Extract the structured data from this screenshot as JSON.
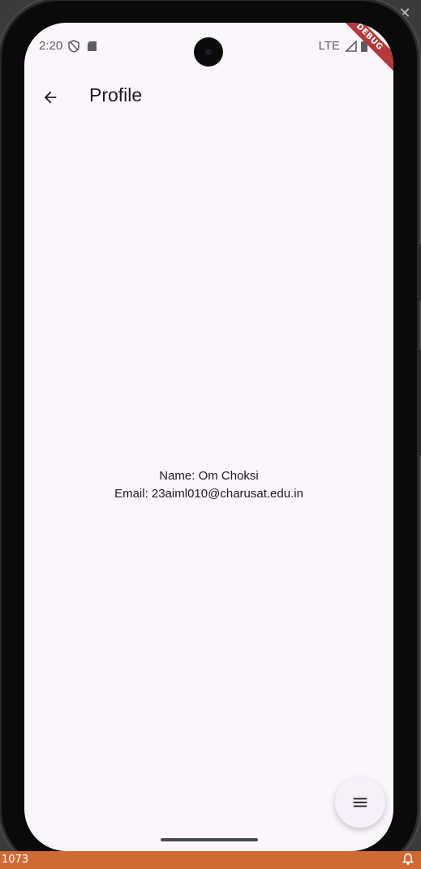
{
  "status_bar": {
    "time": "2:20",
    "network": "LTE",
    "icons_left": [
      "shield-icon",
      "sd-card-icon"
    ],
    "icons_right": [
      "signal-icon",
      "battery-icon"
    ]
  },
  "debug_banner": "DEBUG",
  "appbar": {
    "title": "Profile",
    "back_icon": "arrow-back-icon"
  },
  "profile": {
    "name_line": "Name: Om Choksi",
    "email_line": "Email: 23aiml010@charusat.edu.in"
  },
  "fab": {
    "icon": "menu-icon"
  },
  "host": {
    "status_left": "1073",
    "close_icon": "close-icon",
    "bell_icon": "bell-icon"
  },
  "colors": {
    "background": "#fcf6fc",
    "text": "#1d1b20",
    "fab": "#f6f0fa",
    "debug": "#b23a3a"
  }
}
